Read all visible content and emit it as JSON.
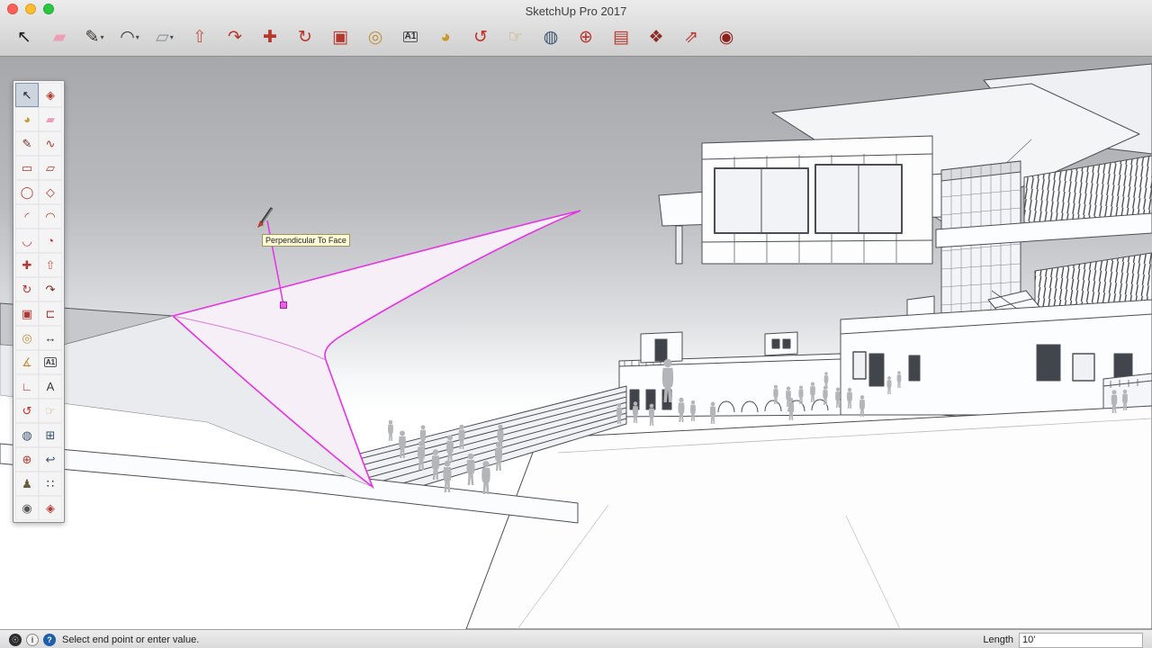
{
  "window": {
    "title": "SketchUp Pro 2017"
  },
  "toolbar": {
    "caret_glyph": "▾",
    "tools": [
      {
        "name": "select-tool",
        "glyph": "↖",
        "color": "#1c1c1e"
      },
      {
        "name": "eraser-tool",
        "glyph": "▰",
        "color": "#eb9fb5"
      },
      {
        "name": "line-tool",
        "glyph": "✎",
        "color": "#3c3430",
        "caret": true
      },
      {
        "name": "arcs-tool",
        "glyph": "◠",
        "color": "#3c3430",
        "caret": true
      },
      {
        "name": "shapes-tool",
        "glyph": "▱",
        "color": "#8b9096",
        "caret": true
      },
      {
        "name": "push-pull-tool",
        "glyph": "⇧",
        "color": "#c2574a"
      },
      {
        "name": "follow-me-tool",
        "glyph": "↷",
        "color": "#b5372e"
      },
      {
        "name": "move-tool",
        "glyph": "✚",
        "color": "#b5372e"
      },
      {
        "name": "rotate-tool",
        "glyph": "↻",
        "color": "#b5372e"
      },
      {
        "name": "scale-tool",
        "glyph": "▣",
        "color": "#b5372e"
      },
      {
        "name": "tape-measure-tool",
        "glyph": "◎",
        "color": "#c0903a"
      },
      {
        "name": "text-tool",
        "glyph": "A1",
        "color": "#2f2f33"
      },
      {
        "name": "paint-bucket-tool",
        "glyph": "◕",
        "color": "#c89a2b"
      },
      {
        "name": "orbit-tool",
        "glyph": "↺",
        "color": "#c03028"
      },
      {
        "name": "pan-tool",
        "glyph": "☞",
        "color": "#d3a96e"
      },
      {
        "name": "zoom-tool",
        "glyph": "◍",
        "color": "#39536e"
      },
      {
        "name": "zoom-extents-tool",
        "glyph": "⊕",
        "color": "#b5372e"
      },
      {
        "name": "section-plane-tool",
        "glyph": "▤",
        "color": "#b5372e"
      },
      {
        "name": "components-tool",
        "glyph": "❖",
        "color": "#8d2d26"
      },
      {
        "name": "share-model-tool",
        "glyph": "⇗",
        "color": "#b5372e"
      },
      {
        "name": "extension-warehouse-tool",
        "glyph": "◉",
        "color": "#8d1f1c"
      }
    ]
  },
  "palette": {
    "tools": [
      {
        "name": "select-tool",
        "glyph": "↖",
        "color": "#1c1c1e",
        "active": true
      },
      {
        "name": "make-component-tool",
        "glyph": "◈",
        "color": "#b5372e"
      },
      {
        "name": "paint-bucket-tool",
        "glyph": "◕",
        "color": "#c89a2b"
      },
      {
        "name": "eraser-tool",
        "glyph": "▰",
        "color": "#eb9fb5"
      },
      {
        "name": "line-tool",
        "glyph": "✎",
        "color": "#6e2a22"
      },
      {
        "name": "freehand-tool",
        "glyph": "∿",
        "color": "#b5372e"
      },
      {
        "name": "rectangle-tool",
        "glyph": "▭",
        "color": "#b5372e"
      },
      {
        "name": "rotated-rectangle-tool",
        "glyph": "▱",
        "color": "#b5372e"
      },
      {
        "name": "circle-tool",
        "glyph": "◯",
        "color": "#b5372e"
      },
      {
        "name": "polygon-tool",
        "glyph": "◇",
        "color": "#b5372e"
      },
      {
        "name": "arc-tool",
        "glyph": "◜",
        "color": "#b5372e"
      },
      {
        "name": "two-point-arc-tool",
        "glyph": "◠",
        "color": "#b5372e"
      },
      {
        "name": "three-point-arc-tool",
        "glyph": "◡",
        "color": "#b5372e"
      },
      {
        "name": "pie-tool",
        "glyph": "◔",
        "color": "#b5372e"
      },
      {
        "name": "move-tool",
        "glyph": "✚",
        "color": "#b5372e"
      },
      {
        "name": "push-pull-tool",
        "glyph": "⇧",
        "color": "#c2574a"
      },
      {
        "name": "rotate-tool",
        "glyph": "↻",
        "color": "#b5372e"
      },
      {
        "name": "follow-me-tool",
        "glyph": "↷",
        "color": "#6e2a22"
      },
      {
        "name": "scale-tool",
        "glyph": "▣",
        "color": "#b5372e"
      },
      {
        "name": "offset-tool",
        "glyph": "⊏",
        "color": "#b5372e"
      },
      {
        "name": "tape-measure-tool",
        "glyph": "◎",
        "color": "#c0903a"
      },
      {
        "name": "dimension-tool",
        "glyph": "↔",
        "color": "#3a3a3e"
      },
      {
        "name": "protractor-tool",
        "glyph": "∡",
        "color": "#c0903a"
      },
      {
        "name": "text-tool",
        "glyph": "A1",
        "color": "#2f2f33"
      },
      {
        "name": "axes-tool",
        "glyph": "∟",
        "color": "#b5372e"
      },
      {
        "name": "3d-text-tool",
        "glyph": "A",
        "color": "#3a3a3e"
      },
      {
        "name": "orbit-tool",
        "glyph": "↺",
        "color": "#c03028"
      },
      {
        "name": "pan-tool",
        "glyph": "☞",
        "color": "#d3a96e"
      },
      {
        "name": "zoom-tool",
        "glyph": "◍",
        "color": "#39536e"
      },
      {
        "name": "zoom-window-tool",
        "glyph": "⊞",
        "color": "#39536e"
      },
      {
        "name": "zoom-extents-tool",
        "glyph": "⊕",
        "color": "#b5372e"
      },
      {
        "name": "previous-view-tool",
        "glyph": "↩",
        "color": "#39536e"
      },
      {
        "name": "position-camera-tool",
        "glyph": "♟",
        "color": "#6b5b3e"
      },
      {
        "name": "walk-tool",
        "glyph": "∷",
        "color": "#2f2f33"
      },
      {
        "name": "look-around-tool",
        "glyph": "◉",
        "color": "#55575c"
      },
      {
        "name": "section-plane-tool",
        "glyph": "◈",
        "color": "#b5372e"
      }
    ]
  },
  "viewport": {
    "tooltip": "Perpendicular To Face"
  },
  "statusbar": {
    "icons": [
      {
        "name": "geolocation-icon",
        "glyph": "☉",
        "bg": "#2c2c31",
        "fg": "#d8dade"
      },
      {
        "name": "credits-icon",
        "glyph": "i",
        "bg": "#f2f2f3",
        "fg": "#4a4a4e",
        "border": "#8a8a8e"
      },
      {
        "name": "help-icon",
        "glyph": "?",
        "bg": "#1f5fa9",
        "fg": "#ffffff"
      }
    ],
    "message": "Select end point or enter value.",
    "length_label": "Length",
    "length_value": "10'"
  }
}
